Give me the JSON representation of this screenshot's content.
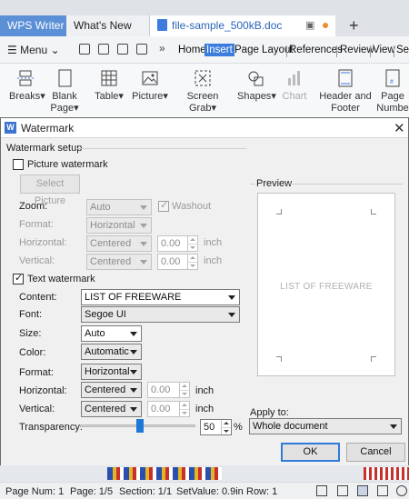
{
  "tabs": {
    "writer": "WPS Writer",
    "whats_new": "What's New",
    "document": "file-sample_500kB.doc"
  },
  "menu": {
    "label": "Menu",
    "ribbon_tabs": [
      "Home",
      "Insert",
      "Page Layout",
      "References",
      "Review",
      "View",
      "Sec"
    ],
    "active_tab": "Insert"
  },
  "ribbon": {
    "breaks": "Breaks",
    "blank_page_1": "Blank",
    "blank_page_2": "Page",
    "table": "Table",
    "picture": "Picture",
    "screen_grab": "Screen Grab",
    "shapes": "Shapes",
    "chart": "Chart",
    "header_footer_1": "Header and",
    "header_footer_2": "Footer",
    "page_number_1": "Page",
    "page_number_2": "Numbe"
  },
  "dialog": {
    "title": "Watermark",
    "setup_label": "Watermark setup",
    "picture_watermark": {
      "label": "Picture watermark",
      "checked": false,
      "select_button": "Select Picture",
      "zoom_label": "Zoom:",
      "zoom_value": "Auto",
      "washout_label": "Washout",
      "washout_checked": true,
      "format_label": "Format:",
      "format_value": "Horizontal",
      "horizontal_label": "Horizontal:",
      "horizontal_value": "Centered",
      "horizontal_offset": "0.00",
      "horizontal_unit": "inch",
      "vertical_label": "Vertical:",
      "vertical_value": "Centered",
      "vertical_offset": "0.00",
      "vertical_unit": "inch"
    },
    "text_watermark": {
      "label": "Text watermark",
      "checked": true,
      "content_label": "Content:",
      "content_value": "LIST OF FREEWARE",
      "font_label": "Font:",
      "font_value": "Segoe UI",
      "size_label": "Size:",
      "size_value": "Auto",
      "color_label": "Color:",
      "color_value": "Automatic",
      "format_label": "Format:",
      "format_value": "Horizontal",
      "horizontal_label": "Horizontal:",
      "horizontal_value": "Centered",
      "horizontal_offset": "0.00",
      "horizontal_unit": "inch",
      "vertical_label": "Vertical:",
      "vertical_value": "Centered",
      "vertical_offset": "0.00",
      "vertical_unit": "inch",
      "transparency_label": "Transparency:",
      "transparency_value": "50",
      "transparency_unit": "%"
    },
    "preview": {
      "label": "Preview",
      "text": "LIST OF FREEWARE"
    },
    "apply_to": {
      "label": "Apply to:",
      "value": "Whole document"
    },
    "ok": "OK",
    "cancel": "Cancel"
  },
  "status": {
    "page_num": "Page Num: 1",
    "page": "Page: 1/5",
    "section": "Section: 1/1",
    "set_value": "SetValue: 0.9in",
    "row": "Row: 1"
  },
  "colors": {
    "accent": "#3b7cdc",
    "ok_border": "#2f7bd8",
    "slider": "#1e78d7",
    "unsaved_dot": "#f08a2c"
  }
}
